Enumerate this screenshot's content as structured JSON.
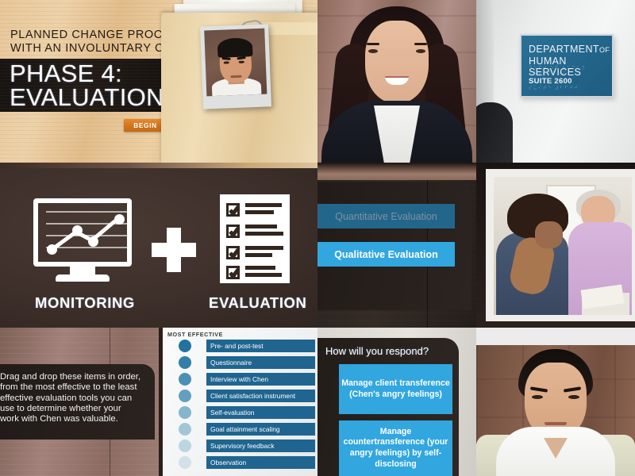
{
  "title_panel": {
    "subtitle_line1": "PLANNED CHANGE PROCESS",
    "subtitle_line2": "WITH AN INVOLUNTARY CLIENT",
    "phase_line1": "PHASE 4:",
    "phase_line2": "EVALUATION",
    "begin_label": "BEGIN"
  },
  "sign_panel": {
    "line1_main": "DEPARTMENT",
    "line1_small": "OF",
    "line2": "HUMAN SERVICES",
    "suite": "SUITE 2600",
    "braille_1": "⠙⠑⠏⠞ ⠕⠋ ⠓⠥⠍⠁⠝ ⠎⠑⠗⠧⠊⠉⠑⠎",
    "braille_2": "⠎⠥⠊⠞⠑ ⠼⠃⠋⠚⠚",
    "board_color": "#24678d"
  },
  "monitoring_panel": {
    "label_monitoring": "MONITORING",
    "label_evaluation": "EVALUATION",
    "plus_symbol": "+"
  },
  "evaluation_type_panel": {
    "buttons": [
      {
        "label": "Quantitative Evaluation",
        "state": "dim",
        "color": "#23668c"
      },
      {
        "label": "Qualitative Evaluation",
        "state": "active",
        "color": "#32a6df"
      }
    ]
  },
  "instruction_panel": {
    "text": "Drag and drop these items in order, from the most effective to the least effective evaluation tools you can use to determine whether your work with Chen was valuable."
  },
  "drag_panel": {
    "header": "MOST EFFECTIVE",
    "items": [
      {
        "label": "Pre- and post-test",
        "dot": "#2272a0"
      },
      {
        "label": "Questionnaire",
        "dot": "#3280a8"
      },
      {
        "label": "Interview with Chen",
        "dot": "#4b90b4"
      },
      {
        "label": "Client satisfaction instrument",
        "dot": "#63a0bf"
      },
      {
        "label": "Self-evaluation",
        "dot": "#85b6ce"
      },
      {
        "label": "Goal attainment scaling",
        "dot": "#a2c6d8"
      },
      {
        "label": "Supervisory feedback",
        "dot": "#bcd5e1"
      },
      {
        "label": "Observation",
        "dot": "#d3e0e7"
      }
    ],
    "item_color": "#1f6590"
  },
  "respond_panel": {
    "question": "How will you respond?",
    "options": [
      {
        "label": "Manage client transference (Chen's angry feelings)"
      },
      {
        "label": "Manage countertransference (your angry feelings) by self-disclosing"
      }
    ],
    "option_color": "#32a6df"
  }
}
